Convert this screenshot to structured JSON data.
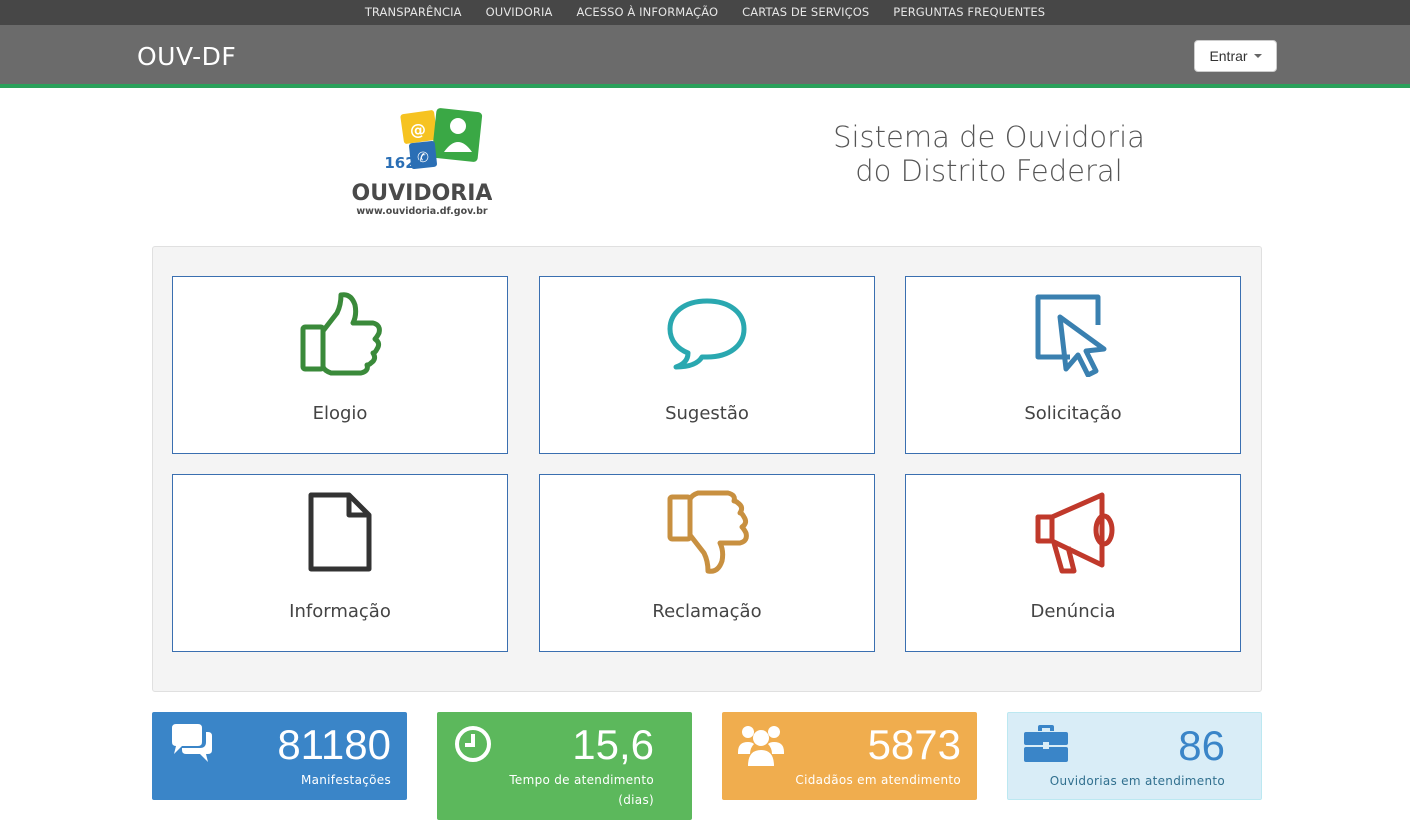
{
  "topnav": {
    "items": [
      "Transparência",
      "Ouvidoria",
      "Acesso à Informação",
      "Cartas de Serviços",
      "Perguntas Frequentes"
    ]
  },
  "header": {
    "brand": "OUV-DF",
    "login_label": "Entrar"
  },
  "logo": {
    "number": "162",
    "text": "OUVIDORIA",
    "url": "www.ouvidoria.df.gov.br"
  },
  "site_title": {
    "line1": "Sistema de Ouvidoria",
    "line2": "do Distrito Federal"
  },
  "cards": [
    {
      "label": "Elogio",
      "icon": "thumbs-up-icon",
      "color": "#3a8a3a"
    },
    {
      "label": "Sugestão",
      "icon": "speech-bubble-icon",
      "color": "#2aa8b0"
    },
    {
      "label": "Solicitação",
      "icon": "pointer-icon",
      "color": "#3a80b0"
    },
    {
      "label": "Informação",
      "icon": "document-icon",
      "color": "#333333"
    },
    {
      "label": "Reclamação",
      "icon": "thumbs-down-icon",
      "color": "#c89040"
    },
    {
      "label": "Denúncia",
      "icon": "megaphone-icon",
      "color": "#c0392b"
    }
  ],
  "stats": [
    {
      "value": "81180",
      "caption": "Manifestações",
      "icon": "comments-icon",
      "color": "#3a85c8"
    },
    {
      "value": "15,6",
      "caption": "Tempo de atendimento (dias)",
      "icon": "clock-icon",
      "color": "#5cb85c"
    },
    {
      "value": "5873",
      "caption": "Cidadãos em atendimento",
      "icon": "users-icon",
      "color": "#f0ad4e"
    },
    {
      "value": "86",
      "caption": "Ouvidorias em atendimento",
      "icon": "briefcase-icon",
      "color": "#d9edf7"
    }
  ]
}
